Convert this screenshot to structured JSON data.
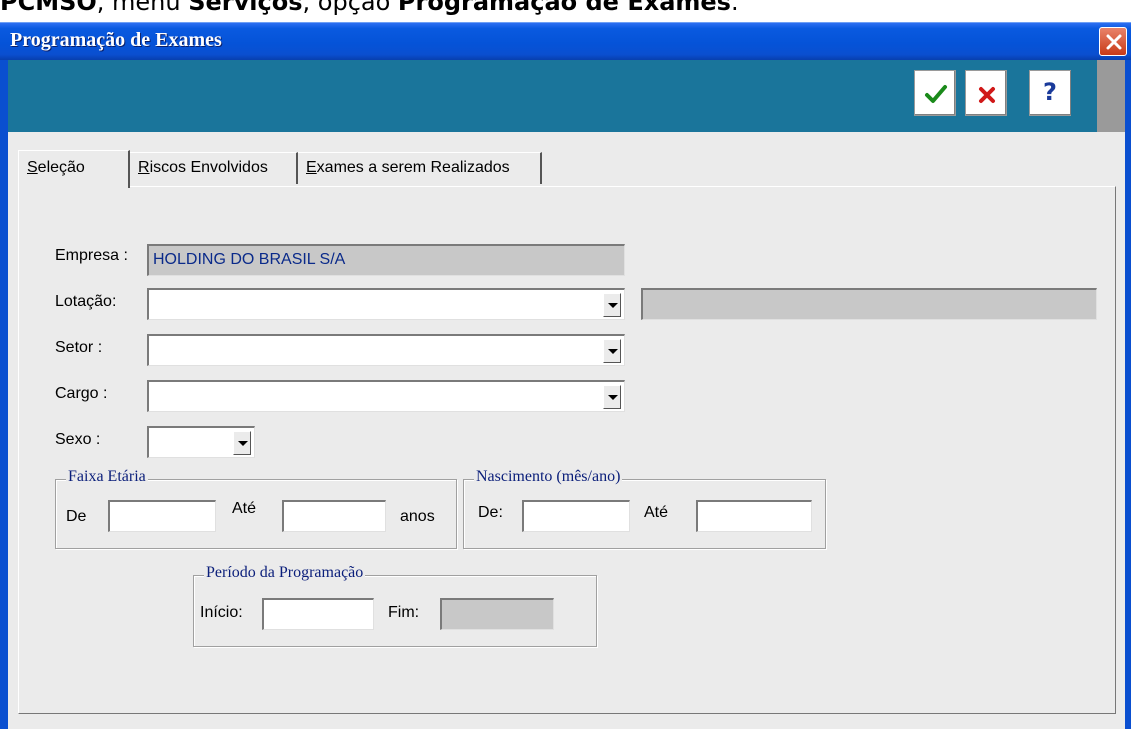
{
  "caption": {
    "prefix_bold": "PCMSO",
    "text1": ", menu ",
    "menu_bold": "Serviços",
    "text2": ", opção ",
    "option_bold": "Programação de Exames",
    "suffix": "."
  },
  "window": {
    "title": "Programação de Exames"
  },
  "toolbar": {
    "confirm_icon": "check-icon",
    "cancel_icon": "x-icon",
    "help_label": "?"
  },
  "tabs": [
    {
      "mnemonic": "S",
      "rest": "eleção"
    },
    {
      "mnemonic": "R",
      "rest": "iscos Envolvidos"
    },
    {
      "mnemonic": "E",
      "rest": "xames a serem Realizados"
    }
  ],
  "form": {
    "empresa_label": "Empresa :",
    "empresa_value": "HOLDING DO BRASIL S/A",
    "lotacao_label": "Lotação:",
    "lotacao_value": "",
    "lotacao_desc": "",
    "setor_label": "Setor :",
    "setor_value": "",
    "cargo_label": "Cargo :",
    "cargo_value": "",
    "sexo_label": "Sexo :",
    "sexo_value": ""
  },
  "faixa": {
    "legend": "Faixa Etária",
    "de_label": "De",
    "ate_label": "Até",
    "anos_label": "anos",
    "de_value": "",
    "ate_value": ""
  },
  "nascimento": {
    "legend": "Nascimento (mês/ano)",
    "de_label": "De:",
    "ate_label": "Até",
    "de_value": "",
    "ate_value": ""
  },
  "periodo": {
    "legend": "Período da Programação",
    "inicio_label": "Início:",
    "fim_label": "Fim:",
    "inicio_value": "",
    "fim_value": ""
  },
  "colors": {
    "titlebar": "#0553d8",
    "toolbar": "#1a759b",
    "dialog_bg": "#ebebeb",
    "confirm": "#1a8a1a",
    "cancel": "#d01818",
    "help": "#1a3a9a"
  }
}
